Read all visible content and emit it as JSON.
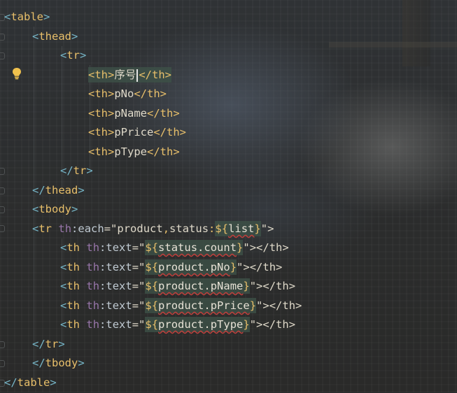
{
  "editor": {
    "lines": [
      {
        "lt": "<",
        "name": "table",
        "gt": ">"
      },
      {
        "lt": "<",
        "name": "thead",
        "gt": ">"
      },
      {
        "lt": "<",
        "name": "tr",
        "gt": ">"
      },
      {
        "open": "<th>",
        "text": "序号",
        "close": "</th>"
      },
      {
        "open": "<th>",
        "text": "pNo",
        "close": "</th>"
      },
      {
        "open": "<th>",
        "text": "pName",
        "close": "</th>"
      },
      {
        "open": "<th>",
        "text": "pPrice",
        "close": "</th>"
      },
      {
        "open": "<th>",
        "text": "pType",
        "close": "</th>"
      },
      {
        "lt": "</",
        "name": "tr",
        "gt": ">"
      },
      {
        "lt": "</",
        "name": "thead",
        "gt": ">"
      },
      {
        "lt": "<",
        "name": "tbody",
        "gt": ">"
      },
      {
        "lt": "<",
        "name": "tr",
        "ns": "th",
        "sep": ":",
        "attr": "each",
        "eq": "=\"",
        "v1": "product",
        "comma": ",",
        "v2": "status",
        "colon": ":",
        "open": "${",
        "expr": "list",
        "close": "}",
        "end": "\">"
      },
      {
        "lt": "<",
        "name": "th",
        "ns": "th",
        "sep": ":",
        "attr": "text",
        "eq": "=\"",
        "open": "${",
        "expr": "status.count",
        "close": "}",
        "end": "\"></th>"
      },
      {
        "lt": "<",
        "name": "th",
        "ns": "th",
        "sep": ":",
        "attr": "text",
        "eq": "=\"",
        "open": "${",
        "expr": "product.pNo",
        "close": "}",
        "end": "\"></th>"
      },
      {
        "lt": "<",
        "name": "th",
        "ns": "th",
        "sep": ":",
        "attr": "text",
        "eq": "=\"",
        "open": "${",
        "expr": "product.pName",
        "close": "}",
        "end": "\"></th>"
      },
      {
        "lt": "<",
        "name": "th",
        "ns": "th",
        "sep": ":",
        "attr": "text",
        "eq": "=\"",
        "open": "${",
        "expr": "product.pPrice",
        "close": "}",
        "end": "\"></th>"
      },
      {
        "lt": "<",
        "name": "th",
        "ns": "th",
        "sep": ":",
        "attr": "text",
        "eq": "=\"",
        "open": "${",
        "expr": "product.pType",
        "close": "}",
        "end": "\"></th>"
      },
      {
        "lt": "</",
        "name": "tr",
        "gt": ">"
      },
      {
        "lt": "</",
        "name": "tbody",
        "gt": ">"
      },
      {
        "lt": "</",
        "name": "table",
        "gt": ">"
      }
    ],
    "intention_icon": "lightbulb-icon",
    "colors": {
      "tag": "#e8bf6a",
      "bracket": "#76b6c8",
      "attribute": "#c0cad2",
      "string": "#6a8759",
      "highlight": "#3e5248",
      "error_underline": "#bc3f3c"
    }
  }
}
